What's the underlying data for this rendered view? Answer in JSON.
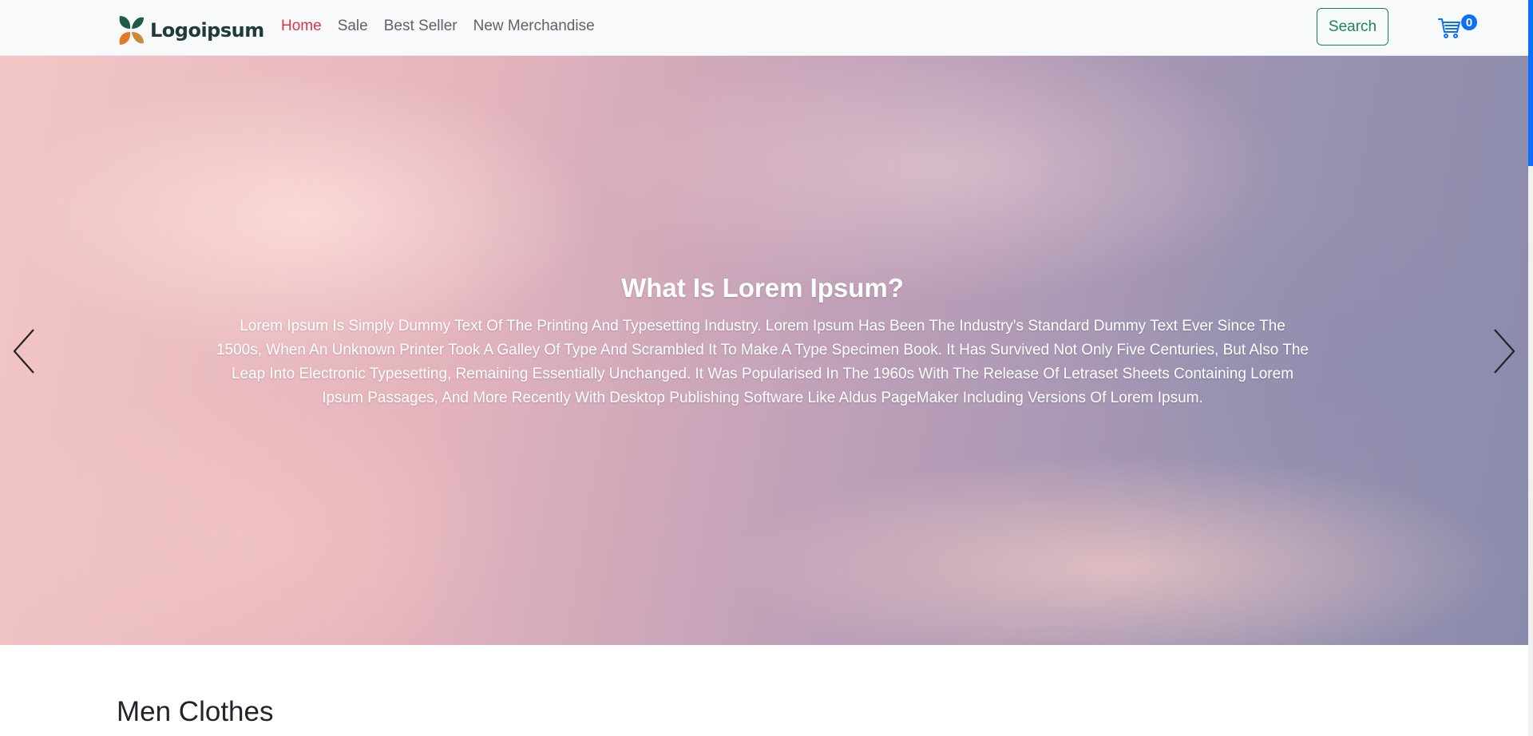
{
  "brand": {
    "name": "Logoipsum"
  },
  "nav": {
    "links": [
      {
        "label": "Home",
        "active": true
      },
      {
        "label": "Sale",
        "active": false
      },
      {
        "label": "Best Seller",
        "active": false
      },
      {
        "label": "New Merchandise",
        "active": false
      }
    ]
  },
  "header": {
    "search_label": "Search",
    "cart_icon": "shopping-cart-icon",
    "cart_count": "0"
  },
  "hero": {
    "title": "What Is Lorem Ipsum?",
    "text": "Lorem Ipsum Is Simply Dummy Text Of The Printing And Typesetting Industry. Lorem Ipsum Has Been The Industry's Standard Dummy Text Ever Since The 1500s, When An Unknown Printer Took A Galley Of Type And Scrambled It To Make A Type Specimen Book. It Has Survived Not Only Five Centuries, But Also The Leap Into Electronic Typesetting, Remaining Essentially Unchanged. It Was Popularised In The 1960s With The Release Of Letraset Sheets Containing Lorem Ipsum Passages, And More Recently With Desktop Publishing Software Like Aldus PageMaker Including Versions Of Lorem Ipsum.",
    "prev_icon": "chevron-left-icon",
    "next_icon": "chevron-right-icon"
  },
  "section": {
    "title": "Men Clothes"
  },
  "colors": {
    "active_link": "#dc3545",
    "search_accent": "#198754",
    "cart_accent": "#0d6efd",
    "navbar_bg": "#f8f9fa"
  }
}
